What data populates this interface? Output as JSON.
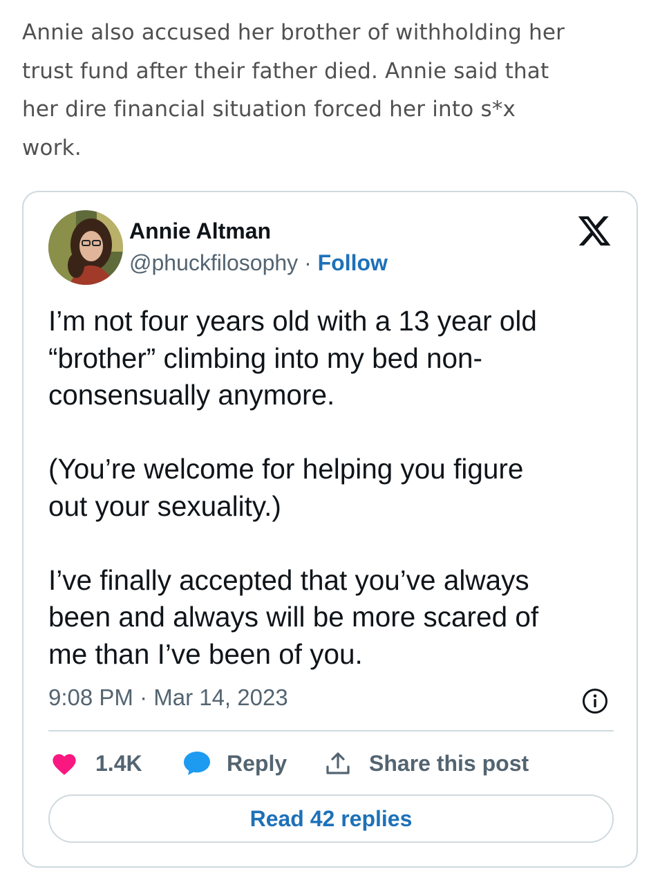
{
  "article": {
    "lines": [
      "Annie also accused her brother of withholding her",
      "trust fund after their father died. Annie said that",
      "her dire financial situation forced her into s*x",
      "work."
    ]
  },
  "tweet": {
    "author_name": "Annie Altman",
    "handle": "@phuckfilosophy",
    "separator": " · ",
    "follow_label": "Follow",
    "paragraphs": [
      [
        "I’m not four years old with a 13 year old",
        "“brother” climbing into my bed non-",
        "consensually anymore."
      ],
      [
        "(You’re welcome for helping you figure",
        "out your sexuality.)"
      ],
      [
        "I’ve finally accepted that you’ve always",
        "been and always will be more scared of",
        "me than I’ve been of you."
      ]
    ],
    "timestamp": "9:08 PM · Mar 14, 2023",
    "like_count": "1.4K",
    "reply_label": "Reply",
    "share_label": "Share this post",
    "read_replies_label": "Read 42 replies"
  },
  "colors": {
    "accent_blue": "#1d71b8",
    "like_pink": "#f91880",
    "reply_blue": "#1d9bf0",
    "muted_text": "#536471",
    "border": "#cfd9de"
  },
  "icons": [
    "x-logo-icon",
    "info-icon",
    "heart-icon",
    "speech-bubble-icon",
    "share-upload-icon"
  ]
}
